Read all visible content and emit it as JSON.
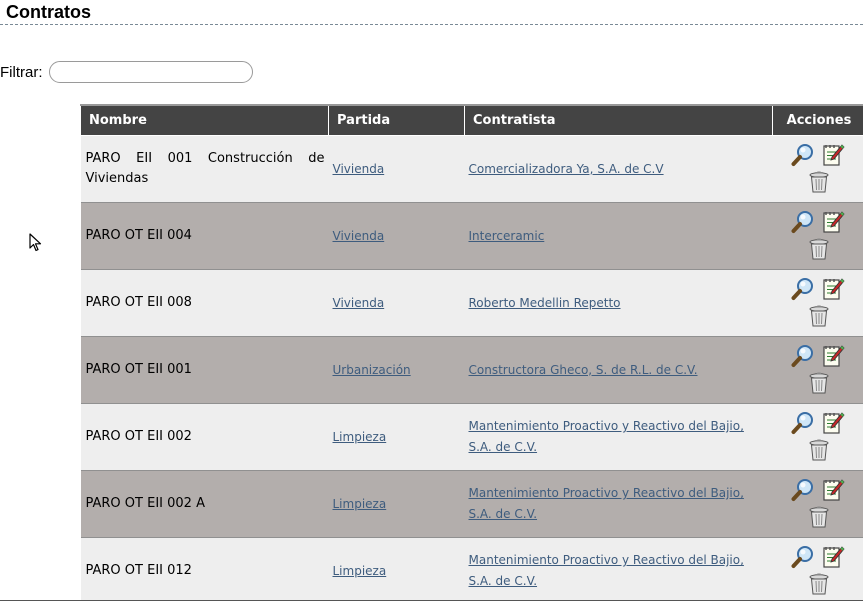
{
  "page": {
    "title": "Contratos"
  },
  "filter": {
    "label": "Filtrar:",
    "value": ""
  },
  "table": {
    "headers": {
      "nombre": "Nombre",
      "partida": "Partida",
      "contratista": "Contratista",
      "acciones": "Acciones"
    },
    "rows": [
      {
        "nombre": "PARO EII 001 Construcción de Viviendas",
        "partida": "Vivienda",
        "contratista": "Comercializadora Ya, S.A. de C.V"
      },
      {
        "nombre": "PARO OT EII 004",
        "partida": "Vivienda",
        "contratista": "Interceramic"
      },
      {
        "nombre": "PARO OT EII 008",
        "partida": "Vivienda",
        "contratista": "Roberto Medellin Repetto"
      },
      {
        "nombre": "PARO OT EII 001",
        "partida": "Urbanización",
        "contratista": "Constructora Gheco, S. de R.L. de C.V."
      },
      {
        "nombre": "PARO OT EII 002",
        "partida": "Limpieza",
        "contratista": "Mantenimiento Proactivo y Reactivo del Bajio, S.A. de C.V."
      },
      {
        "nombre": "PARO OT EII 002 A",
        "partida": "Limpieza",
        "contratista": "Mantenimiento Proactivo y Reactivo del Bajio, S.A. de C.V."
      },
      {
        "nombre": "PARO OT EII 012",
        "partida": "Limpieza",
        "contratista": "Mantenimiento Proactivo y Reactivo del Bajio, S.A. de C.V."
      }
    ]
  },
  "icons": {
    "view": "magnifier-icon",
    "edit": "edit-notepad-icon",
    "delete": "trash-can-icon",
    "cursor": "mouse-pointer-icon"
  },
  "colors": {
    "header_bg": "#444444",
    "row_light": "#eeeeee",
    "row_dark": "#b3aeac",
    "link": "#3e5c7e"
  }
}
